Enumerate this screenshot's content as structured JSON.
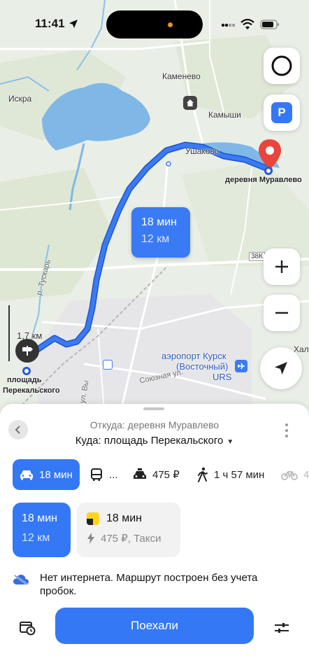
{
  "status_bar": {
    "time": "11:41"
  },
  "map": {
    "labels": {
      "kamenevo": "Каменево",
      "iskra": "Искра",
      "kamyshi": "Камыши",
      "ushakovo": "Ушаково",
      "destination": "деревня Муравлево",
      "distance_scale": "1,7 км",
      "origin_line1": "площадь",
      "origin_line2": "Перекальского",
      "airport_line1": "аэропорт Курск",
      "airport_line2": "(Восточный)",
      "airport_line3": "URS",
      "street_soyuznaya": "Союзная ул.",
      "river": "р. Тускарь",
      "street_vy": "ул. Вы",
      "road_badge": "38К",
      "khal": "Хал"
    },
    "route_callout": {
      "time": "18 мин",
      "distance": "12 км"
    }
  },
  "sheet": {
    "from": "Откуда: деревня Муравлево",
    "to": "Куда: площадь Перекальского",
    "modes": {
      "car": "18 мин",
      "bus": "...",
      "taxi": "475 ₽",
      "walk": "1 ч 57 мин",
      "bike": "4"
    },
    "route_card": {
      "time": "18 мин",
      "distance": "12 км"
    },
    "taxi_card": {
      "time": "18 мин",
      "price": "475 ₽, Такси"
    },
    "notice": "Нет интернета. Маршрут построен без учета пробок.",
    "go_button": "Поехали"
  },
  "colors": {
    "accent": "#3478f6",
    "route": "#3a7bf5",
    "destination_pin": "#e8453c",
    "water": "#7fb8e6"
  }
}
